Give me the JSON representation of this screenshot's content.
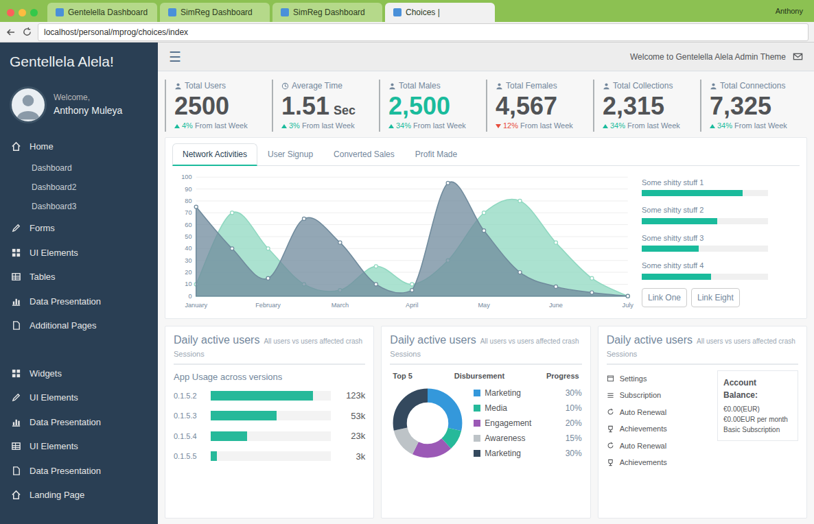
{
  "browser": {
    "tabs": [
      {
        "label": "Gentelella Dashboard",
        "selected": false
      },
      {
        "label": "SimReg Dashboard",
        "selected": false
      },
      {
        "label": "SimReg Dashboard",
        "selected": false
      },
      {
        "label": "Choices |",
        "selected": true
      }
    ],
    "address": "localhost/personal/mprog/choices/index",
    "profile": "Anthony"
  },
  "sidebar": {
    "title": "Gentellela Alela!",
    "welcome": "Welcome,",
    "user": "Anthony Muleya",
    "sections": [
      [
        {
          "label": "Home",
          "kind": "main"
        },
        {
          "label": "Dashboard",
          "kind": "sub"
        },
        {
          "label": "Dashboard2",
          "kind": "sub"
        },
        {
          "label": "Dashboard3",
          "kind": "sub"
        },
        {
          "label": "Forms",
          "kind": "main"
        },
        {
          "label": "UI Elements",
          "kind": "main"
        },
        {
          "label": "Tables",
          "kind": "main"
        },
        {
          "label": "Data Presentation",
          "kind": "main"
        },
        {
          "label": "Additional Pages",
          "kind": "main"
        }
      ],
      [
        {
          "label": "Widgets",
          "kind": "main"
        },
        {
          "label": "UI Elements",
          "kind": "main"
        },
        {
          "label": "Data Presentation",
          "kind": "main"
        },
        {
          "label": "UI Elements",
          "kind": "main"
        },
        {
          "label": "Data Presentation",
          "kind": "main"
        },
        {
          "label": "Landing Page",
          "kind": "main"
        }
      ]
    ]
  },
  "topbar": {
    "toggle": "☰",
    "welcome": "Welcome to Gentelella Alela Admin Theme"
  },
  "stats": [
    {
      "label": "Total Users",
      "value": "2500",
      "change": "4%",
      "note": "From last Week",
      "trend": "up",
      "highlight": false
    },
    {
      "label": "Average Time",
      "value": "1.51",
      "unit": "Sec",
      "change": "3%",
      "note": "From last Week",
      "trend": "up",
      "highlight": false
    },
    {
      "label": "Total Males",
      "value": "2,500",
      "change": "34%",
      "note": "From last Week",
      "trend": "up",
      "highlight": true
    },
    {
      "label": "Total Females",
      "value": "4,567",
      "change": "12%",
      "note": "From last Week",
      "trend": "down",
      "highlight": false
    },
    {
      "label": "Total Collections",
      "value": "2,315",
      "change": "34%",
      "note": "From last Week",
      "trend": "up",
      "highlight": false
    },
    {
      "label": "Total Connections",
      "value": "7,325",
      "change": "34%",
      "note": "From last Week",
      "trend": "up",
      "highlight": false
    }
  ],
  "chart": {
    "tabs": [
      {
        "label": "Network Activities",
        "selected": true
      },
      {
        "label": "User Signup",
        "selected": false
      },
      {
        "label": "Converted Sales",
        "selected": false
      },
      {
        "label": "Profit Made",
        "selected": false
      }
    ],
    "y_ticks": [
      "0",
      "10",
      "20",
      "30",
      "40",
      "50",
      "60",
      "70",
      "80",
      "90",
      "100"
    ],
    "x_labels": [
      "January",
      "February",
      "March",
      "April",
      "May",
      "June",
      "July"
    ],
    "series": [
      {
        "values": [
          10,
          70,
          40,
          10,
          5,
          25,
          10,
          30,
          70,
          80,
          45,
          15,
          0
        ],
        "color": "#8fd8c0"
      },
      {
        "values": [
          75,
          40,
          15,
          65,
          45,
          10,
          5,
          95,
          55,
          20,
          8,
          3,
          0
        ],
        "color": "#6f8a9c"
      }
    ]
  },
  "progress": {
    "items": [
      {
        "label": "Some shitty stuff 1",
        "level": 0.8
      },
      {
        "label": "Some shitty stuff 2",
        "level": 0.6
      },
      {
        "label": "Some shitty stuff 3",
        "level": 0.45
      },
      {
        "label": "Some shitty stuff 4",
        "level": 0.55
      }
    ],
    "buttons": [
      "Link One",
      "Link Eight"
    ]
  },
  "usage_card": {
    "title": "Daily active users",
    "note": "All users vs users affected crash",
    "subtitle": "Sessions",
    "heading": "App Usage across versions",
    "rows": [
      {
        "version": "0.1.5.2",
        "value": "123k",
        "level": 0.85
      },
      {
        "version": "0.1.5.3",
        "value": "53k",
        "level": 0.55
      },
      {
        "version": "0.1.5.4",
        "value": "23k",
        "level": 0.3
      },
      {
        "version": "0.1.5.5",
        "value": "3k",
        "level": 0.05
      }
    ]
  },
  "top5_card": {
    "title": "Daily active users",
    "note": "All users vs users affected crash",
    "subtitle": "Sessions",
    "columns": [
      "Top 5",
      "Disbursement",
      "Progress"
    ],
    "items": [
      {
        "label": "Marketing",
        "pct": "30%",
        "value": 30,
        "color": "#3498DB"
      },
      {
        "label": "Media",
        "pct": "10%",
        "value": 10,
        "color": "#26B99A"
      },
      {
        "label": "Engagement",
        "pct": "20%",
        "value": 20,
        "color": "#9B59B6"
      },
      {
        "label": "Awareness",
        "pct": "15%",
        "value": 15,
        "color": "#BDC3C7"
      },
      {
        "label": "Marketing",
        "pct": "30%",
        "value": 30,
        "color": "#34495E"
      }
    ]
  },
  "settings_card": {
    "title": "Daily active users",
    "note": "All users vs users affected crash",
    "subtitle": "Sessions",
    "items": [
      "Settings",
      "Subscription",
      "Auto Renewal",
      "Achievements",
      "Auto Renewal",
      "Achievements"
    ],
    "balance": {
      "title": "Account Balance:",
      "amount": "€0.00(EUR)",
      "rate": "€0.00EUR per month",
      "plan": "Basic Subscription"
    }
  }
}
